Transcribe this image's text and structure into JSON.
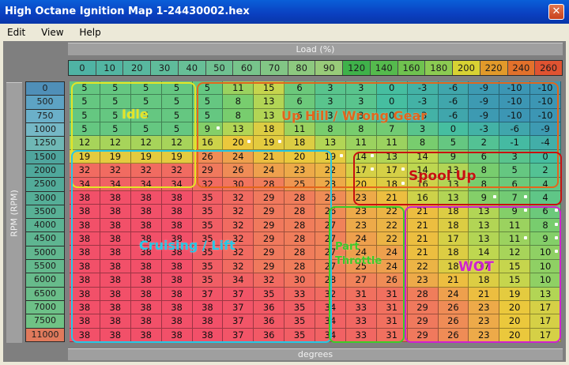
{
  "window": {
    "title": "High Octane Ignition Map 1-24430002.hex",
    "close_glyph": "✕"
  },
  "menu": [
    "Edit",
    "View",
    "Help"
  ],
  "axis": {
    "load_label": "Load (%)",
    "rpm_label": "RPM (RPM)",
    "value_label": "degrees"
  },
  "columns": [
    "0",
    "10",
    "20",
    "30",
    "40",
    "50",
    "60",
    "70",
    "80",
    "90",
    "120",
    "140",
    "160",
    "180",
    "200",
    "220",
    "240",
    "260"
  ],
  "rows": [
    "0",
    "500",
    "750",
    "1000",
    "1250",
    "1500",
    "2000",
    "2500",
    "3000",
    "3500",
    "4000",
    "4500",
    "5000",
    "5500",
    "6000",
    "6500",
    "7000",
    "7500",
    "11000"
  ],
  "cells": [
    [
      "5",
      "5",
      "5",
      "5",
      "5",
      "11",
      "15",
      "6",
      "3",
      "3",
      "0",
      "-3",
      "-6",
      "-9",
      "-10",
      "-10"
    ],
    [
      "5",
      "5",
      "5",
      "5",
      "5",
      "8",
      "13",
      "6",
      "3",
      "3",
      "0",
      "-3",
      "-6",
      "-9",
      "-10",
      "-10"
    ],
    [
      "5",
      "5",
      "5",
      "5",
      "5",
      "8",
      "13",
      "6",
      "3",
      "3",
      "0",
      "-3",
      "-6",
      "-9",
      "-10",
      "-10"
    ],
    [
      "5",
      "5",
      "5",
      "5",
      "9",
      "13",
      "18",
      "11",
      "8",
      "8",
      "7",
      "3",
      "0",
      "-3",
      "-6",
      "-9"
    ],
    [
      "12",
      "12",
      "12",
      "12",
      "16",
      "20",
      "19",
      "18",
      "13",
      "11",
      "11",
      "8",
      "5",
      "2",
      "-1",
      "-4"
    ],
    [
      "19",
      "19",
      "19",
      "19",
      "26",
      "24",
      "21",
      "20",
      "19",
      "14",
      "13",
      "14",
      "9",
      "6",
      "3",
      "0"
    ],
    [
      "32",
      "32",
      "32",
      "32",
      "29",
      "26",
      "24",
      "23",
      "22",
      "17",
      "17",
      "14",
      "13",
      "8",
      "5",
      "2"
    ],
    [
      "34",
      "34",
      "34",
      "34",
      "32",
      "30",
      "28",
      "25",
      "23",
      "20",
      "18",
      "16",
      "13",
      "8",
      "6",
      "4"
    ],
    [
      "38",
      "38",
      "38",
      "38",
      "35",
      "32",
      "29",
      "28",
      "26",
      "23",
      "21",
      "16",
      "13",
      "9",
      "7",
      "4"
    ],
    [
      "38",
      "38",
      "38",
      "38",
      "35",
      "32",
      "29",
      "28",
      "26",
      "23",
      "22",
      "21",
      "18",
      "13",
      "9",
      "6"
    ],
    [
      "38",
      "38",
      "38",
      "38",
      "35",
      "32",
      "29",
      "28",
      "27",
      "23",
      "22",
      "21",
      "18",
      "13",
      "11",
      "8"
    ],
    [
      "38",
      "38",
      "38",
      "38",
      "35",
      "32",
      "29",
      "28",
      "27",
      "24",
      "22",
      "21",
      "17",
      "13",
      "11",
      "9"
    ],
    [
      "38",
      "38",
      "38",
      "38",
      "35",
      "32",
      "29",
      "28",
      "27",
      "24",
      "24",
      "21",
      "18",
      "14",
      "12",
      "10"
    ],
    [
      "38",
      "38",
      "38",
      "38",
      "35",
      "32",
      "29",
      "28",
      "27",
      "25",
      "24",
      "22",
      "18",
      "17",
      "15",
      "10"
    ],
    [
      "38",
      "38",
      "38",
      "38",
      "35",
      "34",
      "32",
      "30",
      "28",
      "27",
      "26",
      "23",
      "21",
      "18",
      "15",
      "10"
    ],
    [
      "38",
      "38",
      "38",
      "38",
      "37",
      "37",
      "35",
      "33",
      "32",
      "31",
      "31",
      "28",
      "24",
      "21",
      "19",
      "13"
    ],
    [
      "38",
      "38",
      "38",
      "38",
      "38",
      "37",
      "36",
      "35",
      "34",
      "33",
      "31",
      "29",
      "26",
      "23",
      "20",
      "17"
    ],
    [
      "38",
      "38",
      "38",
      "38",
      "38",
      "37",
      "36",
      "35",
      "34",
      "33",
      "31",
      "29",
      "26",
      "23",
      "20",
      "17"
    ],
    [
      "38",
      "38",
      "38",
      "38",
      "38",
      "37",
      "36",
      "35",
      "34",
      "33",
      "31",
      "29",
      "26",
      "23",
      "20",
      "17"
    ]
  ],
  "regions": [
    {
      "name": "Idle",
      "color": "#e5e526"
    },
    {
      "name": "Up Hill / Wrong Gear",
      "color": "#e3661c"
    },
    {
      "name": "Spool Up",
      "color": "#c81010"
    },
    {
      "name": "Cruising / Lift",
      "color": "#26c8e6"
    },
    {
      "name": "Part\nThrottle",
      "color": "#3ccc28"
    },
    {
      "name": "WOT",
      "color": "#cf22cf"
    }
  ]
}
